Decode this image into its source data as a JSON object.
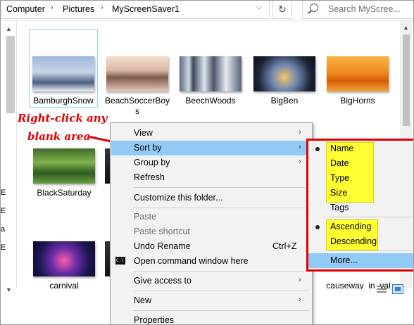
{
  "address": {
    "crumbs": [
      "Computer",
      "Pictures",
      "MyScreenSaver1"
    ],
    "search_placeholder": "Search MyScree..."
  },
  "files": [
    {
      "name": "BamburghSnow",
      "selected": true
    },
    {
      "name": "BeachSoccerBoys",
      "selected": false
    },
    {
      "name": "BeechWoods",
      "selected": false
    },
    {
      "name": "BigBen",
      "selected": false
    },
    {
      "name": "BigHorns",
      "selected": false
    },
    {
      "name": "BlackSaturday",
      "selected": false
    },
    {
      "name": "carnival",
      "selected": false
    },
    {
      "name": "causeway_in_val",
      "selected": false
    }
  ],
  "annotation": {
    "line1": "Right-click any",
    "line2": "blank area",
    "color": "#e00000"
  },
  "context_menu": {
    "view": "View",
    "sort_by": "Sort by",
    "group_by": "Group by",
    "refresh": "Refresh",
    "customize": "Customize this folder...",
    "paste": "Paste",
    "paste_shortcut": "Paste shortcut",
    "undo_rename": "Undo Rename",
    "undo_shortcut": "Ctrl+Z",
    "open_cmd": "Open command window here",
    "give_access": "Give access to",
    "new": "New",
    "properties": "Properties"
  },
  "sort_submenu": {
    "name": "Name",
    "date": "Date",
    "type": "Type",
    "size": "Size",
    "tags": "Tags",
    "ascending": "Ascending",
    "descending": "Descending",
    "more": "More...",
    "selected_field": "Name",
    "selected_order": "Ascending"
  },
  "left_partial_chars": [
    "E",
    "E",
    "a",
    "E"
  ],
  "colors": {
    "highlight": "#91c9f7",
    "annotation_red": "#e00000",
    "yellow_highlight": "#ffff33"
  }
}
